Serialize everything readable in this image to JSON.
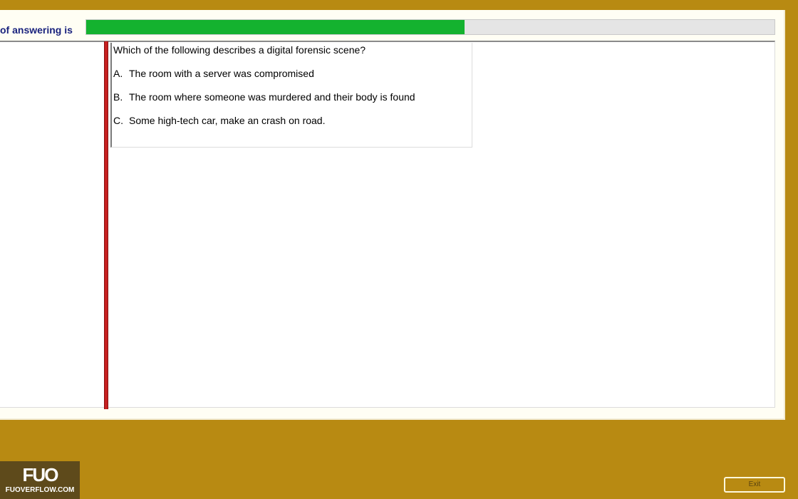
{
  "header": {
    "timer_label": "of answering is",
    "progress": {
      "percent": 55,
      "fill_color": "#14b22f",
      "track_color": "#e5e5e5"
    }
  },
  "question": {
    "text": "Which of the following describes a digital forensic scene?",
    "options": [
      {
        "letter": "A.",
        "text": "The room with a server was compromised"
      },
      {
        "letter": "B.",
        "text": "The room where someone was murdered and their body is found"
      },
      {
        "letter": "C.",
        "text": "Some high-tech car, make an crash on road."
      }
    ]
  },
  "footer": {
    "exit_label": "Exit"
  },
  "watermark": {
    "mark": "FUO",
    "text": "FUOVERFLOW.COM"
  },
  "colors": {
    "background": "#b88a12",
    "accent_red": "#c62020",
    "label_blue": "#1a237e"
  }
}
